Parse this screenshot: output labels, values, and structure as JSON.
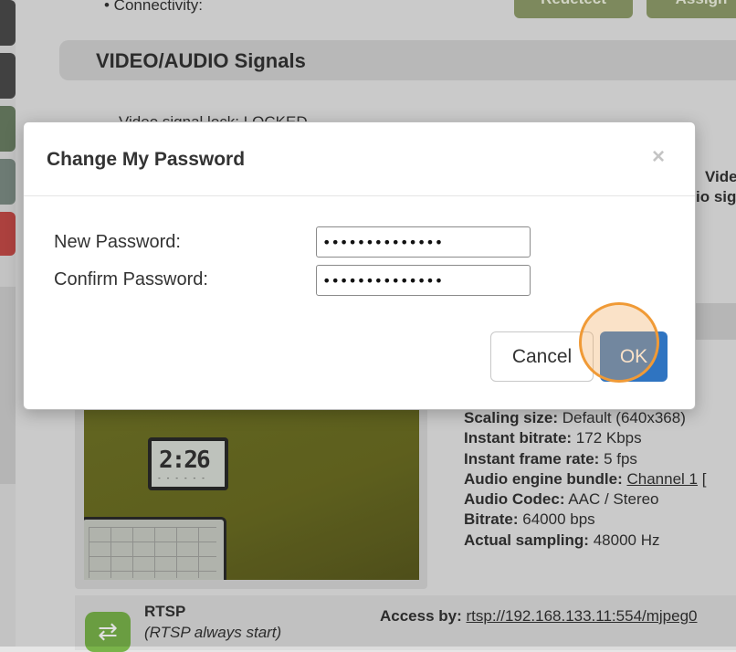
{
  "background": {
    "connectivity_bullet": "• Connectivity:",
    "top_buttons": [
      "Redetect",
      "Assign"
    ],
    "section_title": "VIDEO/AUDIO Signals",
    "video_signal_line": "Video signal lock: LOCKED",
    "right_fragments": [
      "Vide",
      "io sig"
    ],
    "clock_display": "2:26",
    "info": {
      "scaling_size_label": "Scaling size:",
      "scaling_size_value": "Default (640x368)",
      "instant_bitrate_label": "Instant bitrate:",
      "instant_bitrate_value": "172 Kbps",
      "instant_frame_rate_label": "Instant frame rate:",
      "instant_frame_rate_value": "5 fps",
      "audio_engine_label": "Audio engine bundle:",
      "audio_engine_value": "Channel 1",
      "audio_engine_suffix": "[",
      "audio_codec_label": "Audio Codec:",
      "audio_codec_value": "AAC / Stereo",
      "bitrate_label": "Bitrate:",
      "bitrate_value": "64000 bps",
      "actual_sampling_label": "Actual sampling:",
      "actual_sampling_value": "48000 Hz"
    },
    "rtsp": {
      "title": "RTSP",
      "subtitle": "(RTSP always start)",
      "access_label": "Access by:",
      "access_url": "rtsp://192.168.133.11:554/mjpeg0"
    }
  },
  "dialog": {
    "title": "Change My Password",
    "close_symbol": "×",
    "new_password_label": "New Password:",
    "new_password_value": "••••••••••••••",
    "confirm_password_label": "Confirm Password:",
    "confirm_password_value": "••••••••••••••",
    "cancel_label": "Cancel",
    "ok_label": "OK"
  },
  "colors": {
    "ok_button": "#2f74c1",
    "click_highlight": "#f09a36",
    "rtsp_icon": "#79b34a",
    "top_button": "#8f9c6a"
  }
}
